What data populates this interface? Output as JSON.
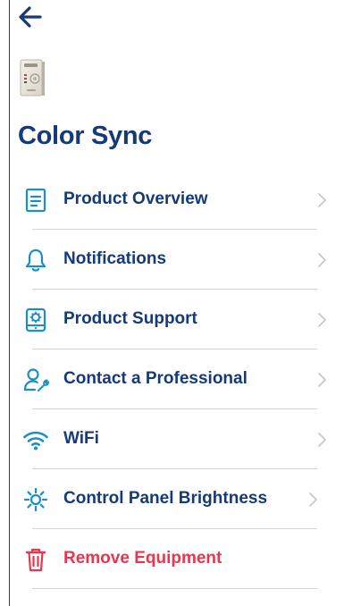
{
  "header": {
    "back_icon": "arrow-left-icon",
    "title": "Color Sync"
  },
  "device": {
    "thumbnail_icon": "wall-control-panel-image"
  },
  "menu": {
    "items": [
      {
        "label": "Product Overview",
        "icon": "document-icon",
        "chevron": true
      },
      {
        "label": "Notifications",
        "icon": "bell-icon",
        "chevron": true
      },
      {
        "label": "Product Support",
        "icon": "tablet-gear-icon",
        "chevron": true
      },
      {
        "label": "Contact a Professional",
        "icon": "person-wrench-icon",
        "chevron": true
      },
      {
        "label": "WiFi",
        "icon": "wifi-icon",
        "chevron": true
      },
      {
        "label": "Control Panel Brightness",
        "icon": "sun-icon",
        "chevron": true
      },
      {
        "label": "Remove Equipment",
        "icon": "trash-icon",
        "chevron": false
      }
    ]
  },
  "colors": {
    "primary": "#153a78",
    "icon_accent": "#1a8fc4",
    "danger": "#e8364f",
    "divider": "#d6d6d6",
    "chevron": "#c8c8c8"
  }
}
